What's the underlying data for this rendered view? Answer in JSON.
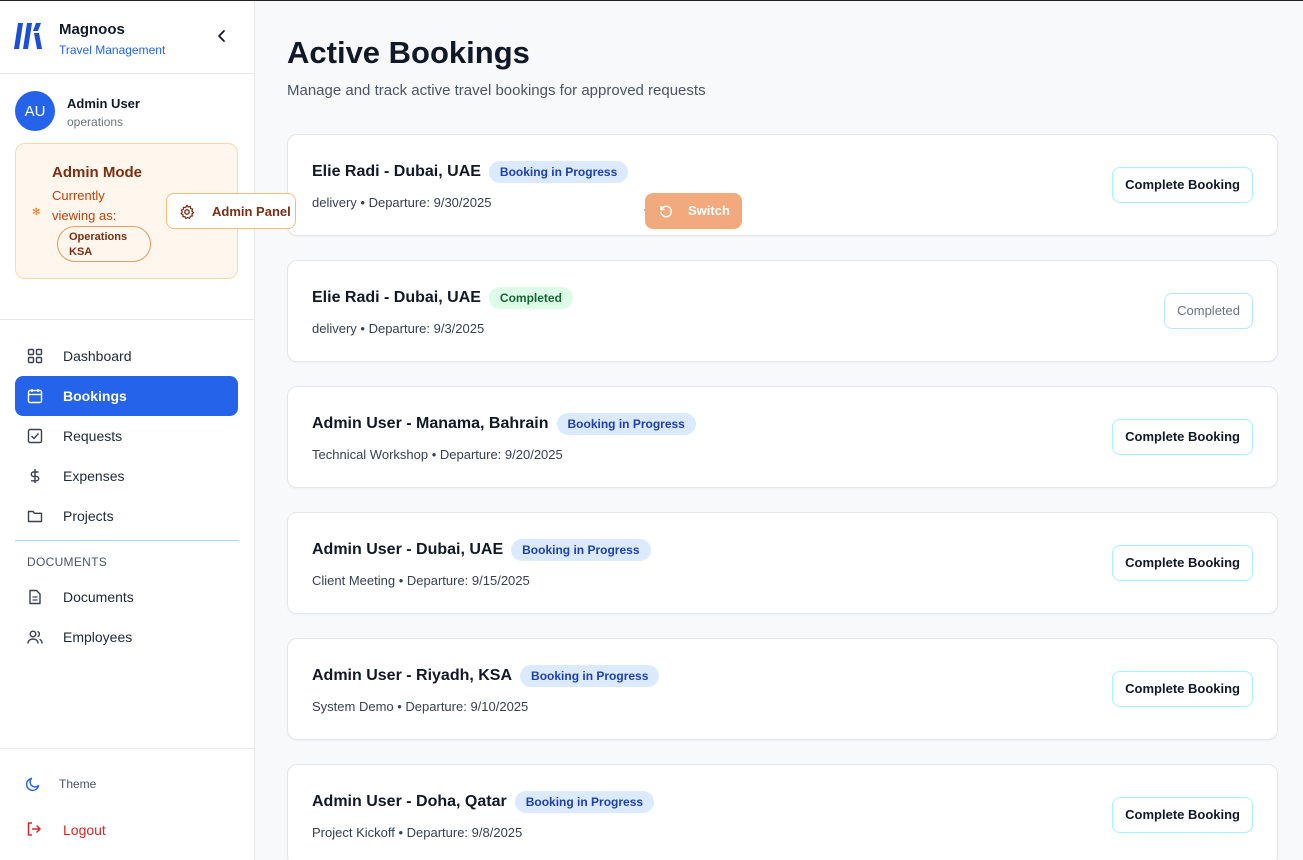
{
  "brand": {
    "name": "Magnoos",
    "subtitle": "Travel Management"
  },
  "user": {
    "initials": "AU",
    "name": "Admin User",
    "role": "operations"
  },
  "admin_mode": {
    "title": "Admin Mode",
    "viewing_label": "Currently viewing as:",
    "viewing_as": "Operations KSA",
    "panel_button": "Admin Panel",
    "switch_button": "Switch"
  },
  "nav": {
    "items": [
      {
        "label": "Dashboard",
        "icon": "grid-icon"
      },
      {
        "label": "Bookings",
        "icon": "calendar-icon",
        "active": true
      },
      {
        "label": "Requests",
        "icon": "check-square-icon"
      },
      {
        "label": "Expenses",
        "icon": "dollar-icon"
      },
      {
        "label": "Projects",
        "icon": "folder-icon"
      }
    ],
    "section_label": "DOCUMENTS",
    "doc_items": [
      {
        "label": "Documents",
        "icon": "file-icon"
      },
      {
        "label": "Employees",
        "icon": "users-icon"
      }
    ],
    "theme": "Theme",
    "logout": "Logout"
  },
  "page": {
    "title": "Active Bookings",
    "subtitle": "Manage and track active travel bookings for approved requests"
  },
  "bookings": [
    {
      "title": "Elie Radi - Dubai, UAE",
      "status": "Booking in Progress",
      "meta": "delivery • Departure: 9/30/2025",
      "action": "Complete Booking"
    },
    {
      "title": "Elie Radi - Dubai, UAE",
      "status": "Completed",
      "meta": "delivery • Departure: 9/3/2025",
      "action": "Completed"
    },
    {
      "title": "Admin User - Manama, Bahrain",
      "status": "Booking in Progress",
      "meta": "Technical Workshop • Departure: 9/20/2025",
      "action": "Complete Booking"
    },
    {
      "title": "Admin User - Dubai, UAE",
      "status": "Booking in Progress",
      "meta": "Client Meeting • Departure: 9/15/2025",
      "action": "Complete Booking"
    },
    {
      "title": "Admin User - Riyadh, KSA",
      "status": "Booking in Progress",
      "meta": "System Demo • Departure: 9/10/2025",
      "action": "Complete Booking"
    },
    {
      "title": "Admin User - Doha, Qatar",
      "status": "Booking in Progress",
      "meta": "Project Kickoff • Departure: 9/8/2025",
      "action": "Complete Booking"
    }
  ],
  "colors": {
    "primary": "#2563eb",
    "admin_bg": "#fff7ed",
    "admin_accent": "#f97316",
    "badge_progress": "#dbeafe",
    "badge_done": "#dcfce7",
    "logout": "#dc2626"
  }
}
